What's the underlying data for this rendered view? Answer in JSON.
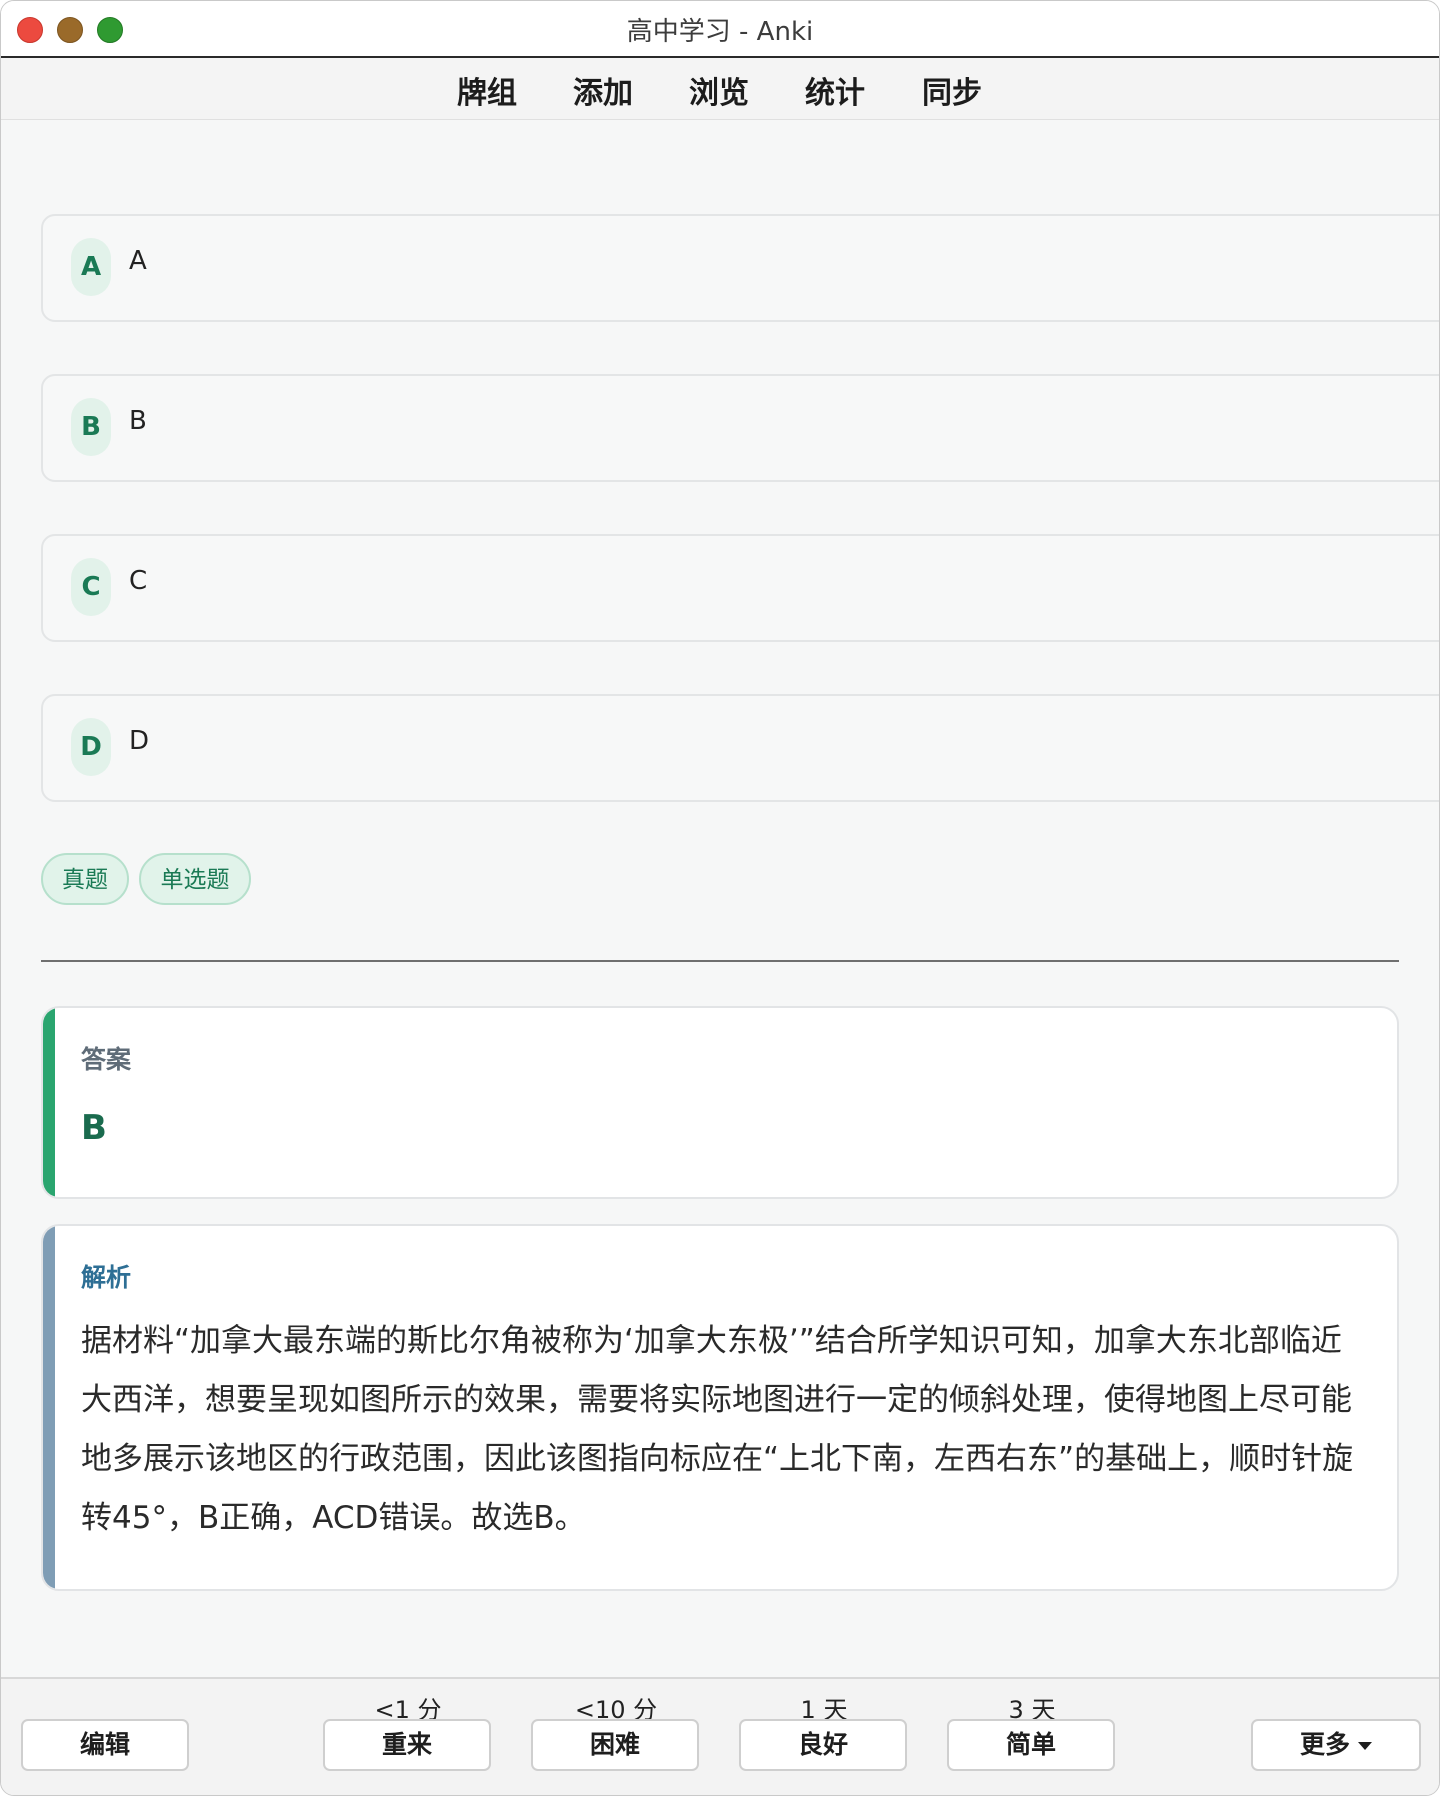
{
  "window": {
    "title": "高中学习 - Anki"
  },
  "toolbar": {
    "decks": "牌组",
    "add": "添加",
    "browse": "浏览",
    "stats": "统计",
    "sync": "同步"
  },
  "options": [
    {
      "letter": "A",
      "text": "A"
    },
    {
      "letter": "B",
      "text": "B"
    },
    {
      "letter": "C",
      "text": "C"
    },
    {
      "letter": "D",
      "text": "D"
    }
  ],
  "tags": [
    "真题",
    "单选题"
  ],
  "answer": {
    "label": "答案",
    "value": "B",
    "accent_color": "#2aa56f"
  },
  "explanation": {
    "label": "解析",
    "text": "据材料“加拿大最东端的斯比尔角被称为‘加拿大东极’”结合所学知识可知，加拿大东北部临近大西洋，想要呈现如图所示的效果，需要将实际地图进行一定的倾斜处理，使得地图上尽可能地多展示该地区的行政范围，因此该图指向标应在“上北下南，左西右东”的基础上，顺时针旋转45°，B正确，ACD错误。故选B。",
    "accent_color": "#7f9db5"
  },
  "bottom": {
    "edit": "编辑",
    "again": {
      "label": "重来",
      "interval": "<1 分"
    },
    "hard": {
      "label": "困难",
      "interval": "<10 分"
    },
    "good": {
      "label": "良好",
      "interval": "1 天"
    },
    "easy": {
      "label": "简单",
      "interval": "3 天"
    },
    "more": "更多"
  },
  "colors": {
    "accent_green": "#1a7a55",
    "tag_bg": "#e1f3ea",
    "label_gray": "#5f6c78",
    "label_blue": "#2e6f95"
  }
}
